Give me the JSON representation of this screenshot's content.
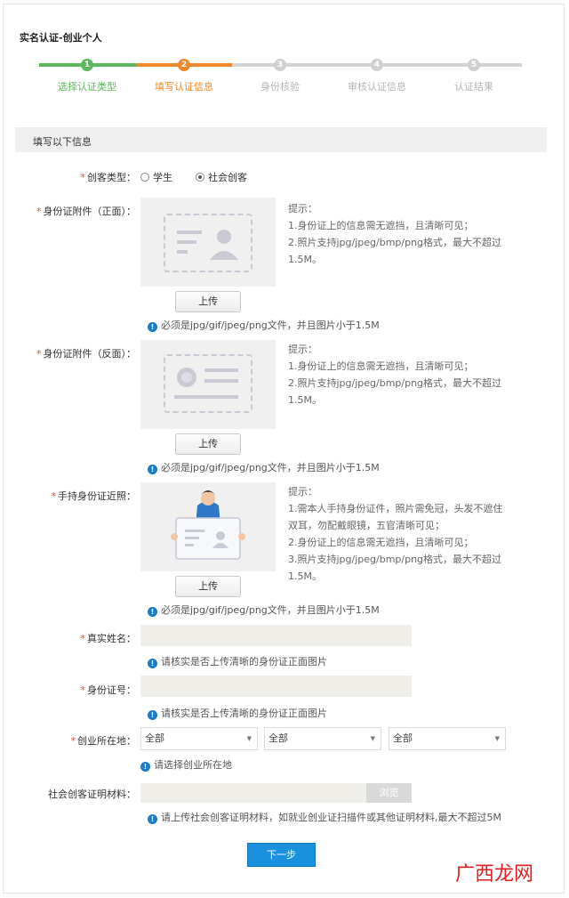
{
  "page_title": "实名认证-创业个人",
  "steps": [
    {
      "num": "1",
      "label": "选择认证类型",
      "status": "done",
      "color": "#5cb85c"
    },
    {
      "num": "2",
      "label": "填写认证信息",
      "status": "current",
      "color": "#f0882d"
    },
    {
      "num": "3",
      "label": "身份核验",
      "status": "pending",
      "color": "#cccccc"
    },
    {
      "num": "4",
      "label": "审核认证信息",
      "status": "pending",
      "color": "#cccccc"
    },
    {
      "num": "5",
      "label": "认证结果",
      "status": "pending",
      "color": "#cccccc"
    }
  ],
  "section_title": "填写以下信息",
  "required_mark": "*",
  "type_field": {
    "label": "创客类型：",
    "options": [
      {
        "label": "学生",
        "checked": false
      },
      {
        "label": "社会创客",
        "checked": true
      }
    ]
  },
  "id_front": {
    "label": "身份证附件（正面）：",
    "tips": [
      "提示：",
      "1.身份证上的信息需无遮挡，且清晰可见；",
      "2.照片支持jpg/jpeg/bmp/png格式，最大不超过1.5M。"
    ],
    "upload_label": "上传",
    "note": "必须是jpg/gif/jpeg/png文件，并且图片小于1.5M"
  },
  "id_back": {
    "label": "身份证附件（反面）：",
    "tips": [
      "提示：",
      "1.身份证上的信息需无遮挡，且清晰可见；",
      "2.照片支持jpg/jpeg/bmp/png格式，最大不超过1.5M。"
    ],
    "upload_label": "上传",
    "note": "必须是jpg/gif/jpeg/png文件，并且图片小于1.5M"
  },
  "id_hand": {
    "label": "手持身份证近照：",
    "tips": [
      "提示：",
      "1.需本人手持身份证件，照片需免冠，头发不遮住双耳，勿配戴眼镜，五官清晰可见；",
      "2.身份证上的信息需无遮挡，且清晰可见；",
      "3.照片支持jpg/jpeg/bmp/png格式，最大不超过1.5M。"
    ],
    "upload_label": "上传",
    "note": "必须是jpg/gif/jpeg/png文件，并且图片小于1.5M"
  },
  "real_name": {
    "label": "真实姓名：",
    "value": "",
    "note": "请核实是否上传清晰的身份证正面图片"
  },
  "id_number": {
    "label": "身份证号：",
    "value": "",
    "note": "请核实是否上传清晰的身份证正面图片"
  },
  "location": {
    "label": "创业所在地：",
    "selects": [
      "全部",
      "全部",
      "全部"
    ],
    "note": "请选择创业所在地"
  },
  "proof": {
    "label": "社会创客证明材料：",
    "browse_label": "浏览",
    "note": "请上传社会创客证明材料，如就业创业证扫描件或其他证明材料,最大不超过5M"
  },
  "next_label": "下一步",
  "watermark": "广西龙网"
}
